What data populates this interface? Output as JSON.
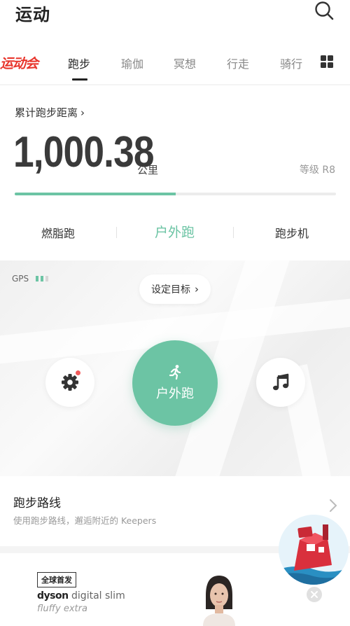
{
  "header": {
    "title": "运动",
    "search_icon": "search-icon"
  },
  "tabs": {
    "logo": "运动会",
    "items": [
      {
        "label": "跑步",
        "active": true
      },
      {
        "label": "瑜伽"
      },
      {
        "label": "冥想"
      },
      {
        "label": "行走"
      },
      {
        "label": "骑行"
      }
    ],
    "more_icon": "grid-icon"
  },
  "stats": {
    "distance_label": "累计跑步距离",
    "distance_value": "1,000.38",
    "distance_unit": "公里",
    "level": "等级 R8",
    "progress": 0.5
  },
  "modes": [
    {
      "label": "燃脂跑"
    },
    {
      "label": "户外跑",
      "active": true
    },
    {
      "label": "跑步机"
    }
  ],
  "map": {
    "gps_label": "GPS",
    "gps_bars": [
      "#6cc4a4",
      "#6cc4a4",
      "#d6d6d6"
    ],
    "goal_button": "设定目标",
    "start_label": "户外跑",
    "settings_icon": "gear-icon",
    "music_icon": "music-note-icon",
    "start_icon": "runner-icon"
  },
  "route": {
    "title": "跑步路线",
    "subtitle": "使用跑步路线，邂逅附近的 Keepers"
  },
  "ad": {
    "badge": "全球首发",
    "brand": "dyson",
    "product": "digital slim",
    "subline": "fluffy extra"
  },
  "colors": {
    "accent": "#6cc4a4",
    "logo": "#e8352c",
    "alert_dot": "#f25b5b"
  }
}
